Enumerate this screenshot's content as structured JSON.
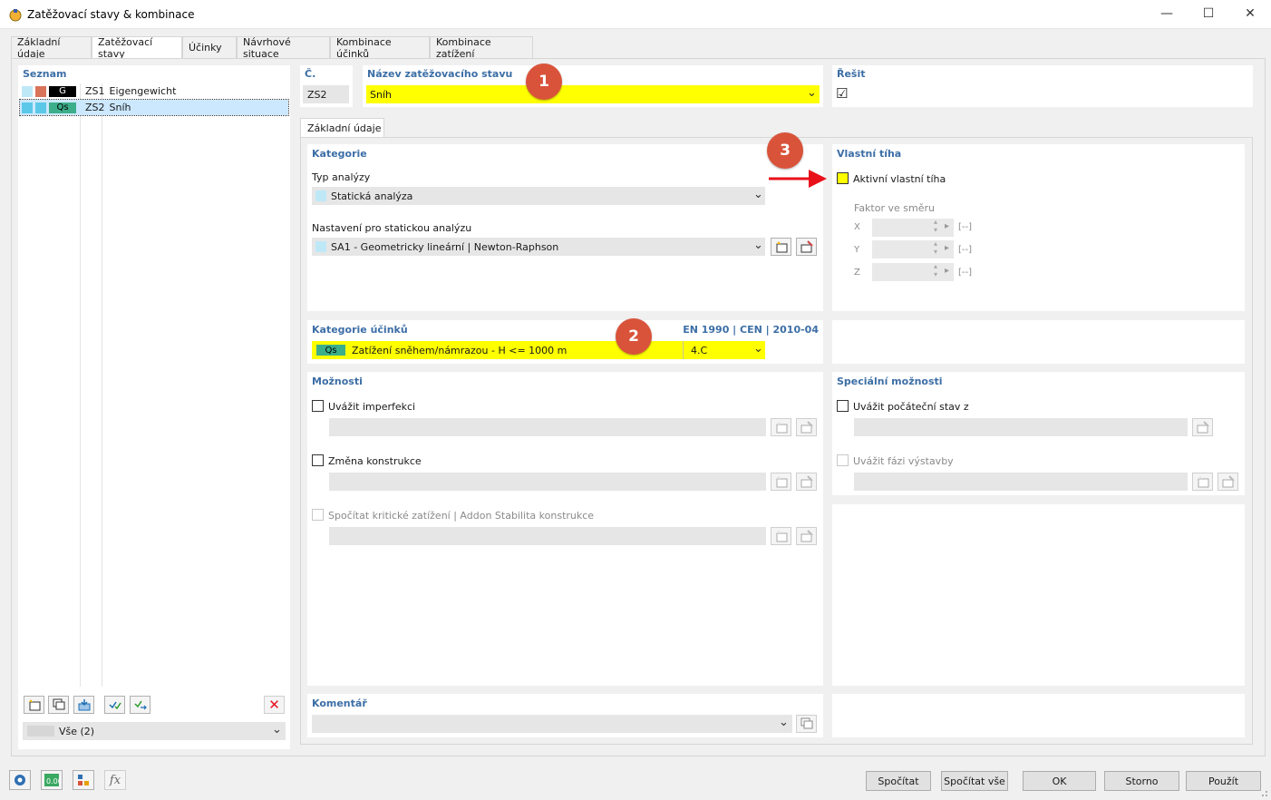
{
  "window": {
    "title": "Zatěžovací stavy & kombinace",
    "minimize_glyph": "—",
    "maximize_glyph": "☐",
    "close_glyph": "✕"
  },
  "tabs": [
    {
      "label": "Základní údaje"
    },
    {
      "label": "Zatěžovací stavy"
    },
    {
      "label": "Účinky"
    },
    {
      "label": "Návrhové situace"
    },
    {
      "label": "Kombinace účinků"
    },
    {
      "label": "Kombinace zatížení"
    }
  ],
  "list": {
    "header": "Seznam",
    "items": [
      {
        "tag": "G",
        "id": "ZS1",
        "name": "Eigengewicht",
        "color1": "#bfe8f7",
        "color2": "#d9735a",
        "tag_bg": "#000000",
        "tag_fg": "#ffffff"
      },
      {
        "tag": "Qs",
        "id": "ZS2",
        "name": "Sníh",
        "color1": "#5bc8e8",
        "color2": "#5bc8e8",
        "tag_bg": "#3cae8a",
        "tag_fg": "#000000"
      }
    ],
    "filter_value": "Vše (2)"
  },
  "header_fields": {
    "number_label": "Č.",
    "number_value": "ZS2",
    "name_label": "Název zatěžovacího stavu",
    "name_value": "Sníh",
    "solve_label": "Řešit",
    "solve_checked": "☑"
  },
  "subtab": {
    "label": "Základní údaje"
  },
  "category": {
    "header": "Kategorie",
    "analysis_type_label": "Typ analýzy",
    "analysis_type_value": "Statická analýza",
    "static_settings_label": "Nastavení pro statickou analýzu",
    "static_settings_value": "SA1 - Geometricky lineární | Newton-Raphson"
  },
  "self_weight": {
    "header": "Vlastní tíha",
    "active_label": "Aktivní vlastní tíha",
    "factor_label": "Faktor ve směru",
    "axes": [
      {
        "axis": "X",
        "unit": "[--]"
      },
      {
        "axis": "Y",
        "unit": "[--]"
      },
      {
        "axis": "Z",
        "unit": "[--]"
      }
    ]
  },
  "action_category": {
    "header": "Kategorie účinků",
    "standard": "EN 1990 | CEN | 2010-04",
    "tag": "Qs",
    "value": "Zatížení sněhem/námrazou - H <= 1000 m",
    "code": "4.C"
  },
  "options": {
    "header": "Možnosti",
    "imperfection_label": "Uvážit imperfekci",
    "structure_change_label": "Změna konstrukce",
    "critical_load_label": "Spočítat kritické zatížení | Addon Stabilita konstrukce"
  },
  "special_options": {
    "header": "Speciální možnosti",
    "initial_state_label": "Uvážit počáteční stav z",
    "construction_phase_label": "Uvážit fázi výstavby"
  },
  "comment": {
    "header": "Komentář"
  },
  "callouts": [
    "1",
    "2",
    "3"
  ],
  "buttons": {
    "calculate": "Spočítat",
    "calculate_all": "Spočítat vše",
    "ok": "OK",
    "cancel": "Storno",
    "apply": "Použít"
  },
  "icons": {
    "chevron": "⌄",
    "delete": "✕",
    "spin_up": "▴",
    "spin_down": "▾",
    "spin_right": "▸",
    "check": "✓"
  },
  "colors": {
    "highlight_yellow": "#ffff00",
    "label_blue": "#3c6ea6",
    "callout_red": "#d9533a",
    "arrow_red": "#e8111a",
    "selection_blue": "#cce8ff"
  }
}
